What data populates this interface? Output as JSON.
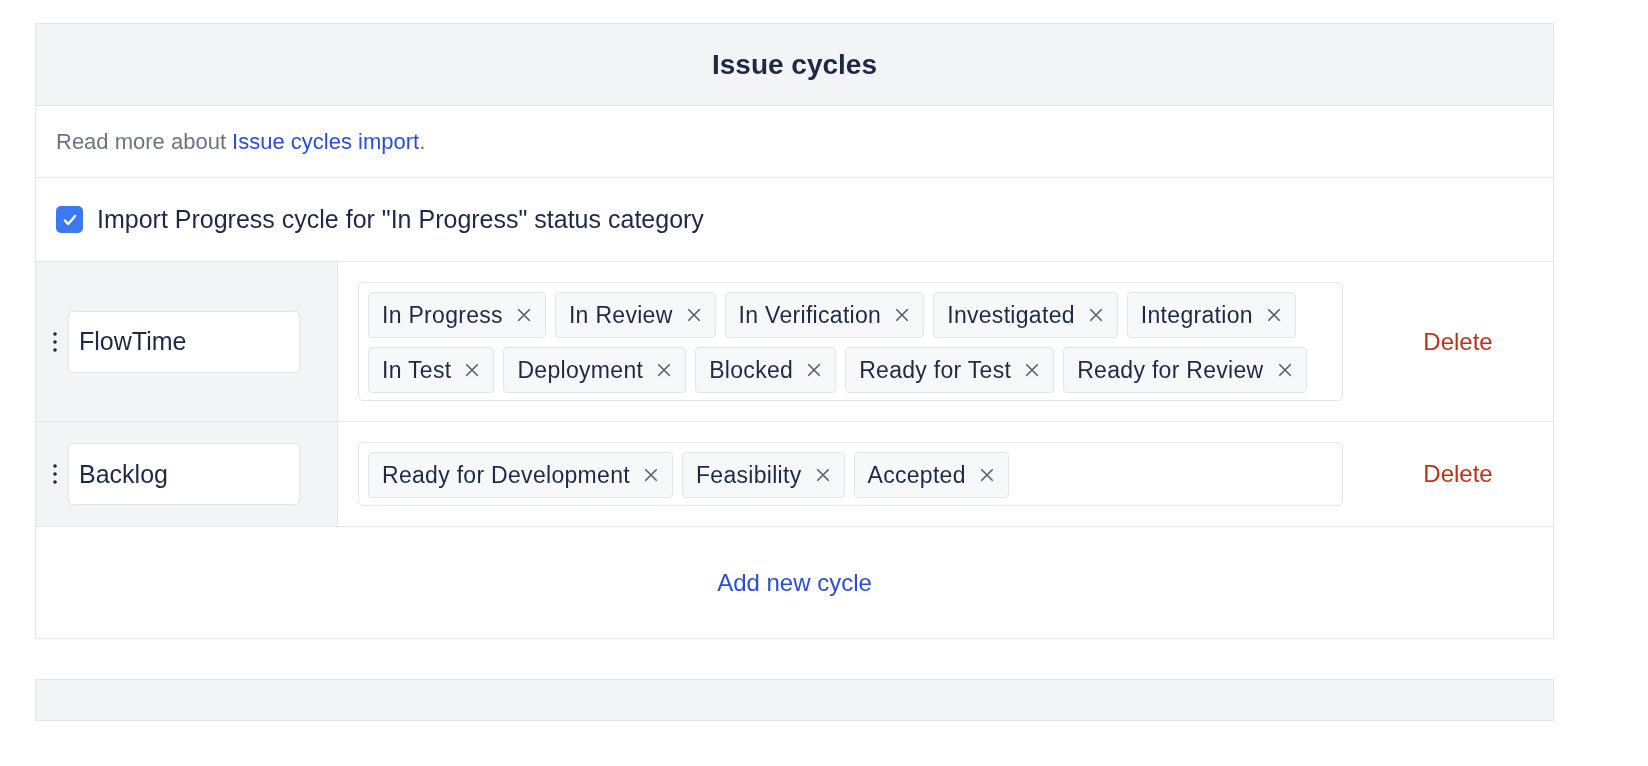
{
  "panel": {
    "title": "Issue cycles"
  },
  "info": {
    "text": "Read more about ",
    "link": "Issue cycles import",
    "suffix": "."
  },
  "import_option": {
    "label": "Import Progress cycle for \"In Progress\" status category",
    "checked": true
  },
  "cycles": [
    {
      "name": "FlowTime",
      "statuses": [
        "In Progress",
        "In Review",
        "In Verification",
        "Investigated",
        "Integration",
        "In Test",
        "Deployment",
        "Blocked",
        "Ready for Test",
        "Ready for Review"
      ],
      "action": "Delete"
    },
    {
      "name": "Backlog",
      "statuses": [
        "Ready for Development",
        "Feasibility",
        "Accepted"
      ],
      "action": "Delete"
    }
  ],
  "add_button": "Add new cycle"
}
